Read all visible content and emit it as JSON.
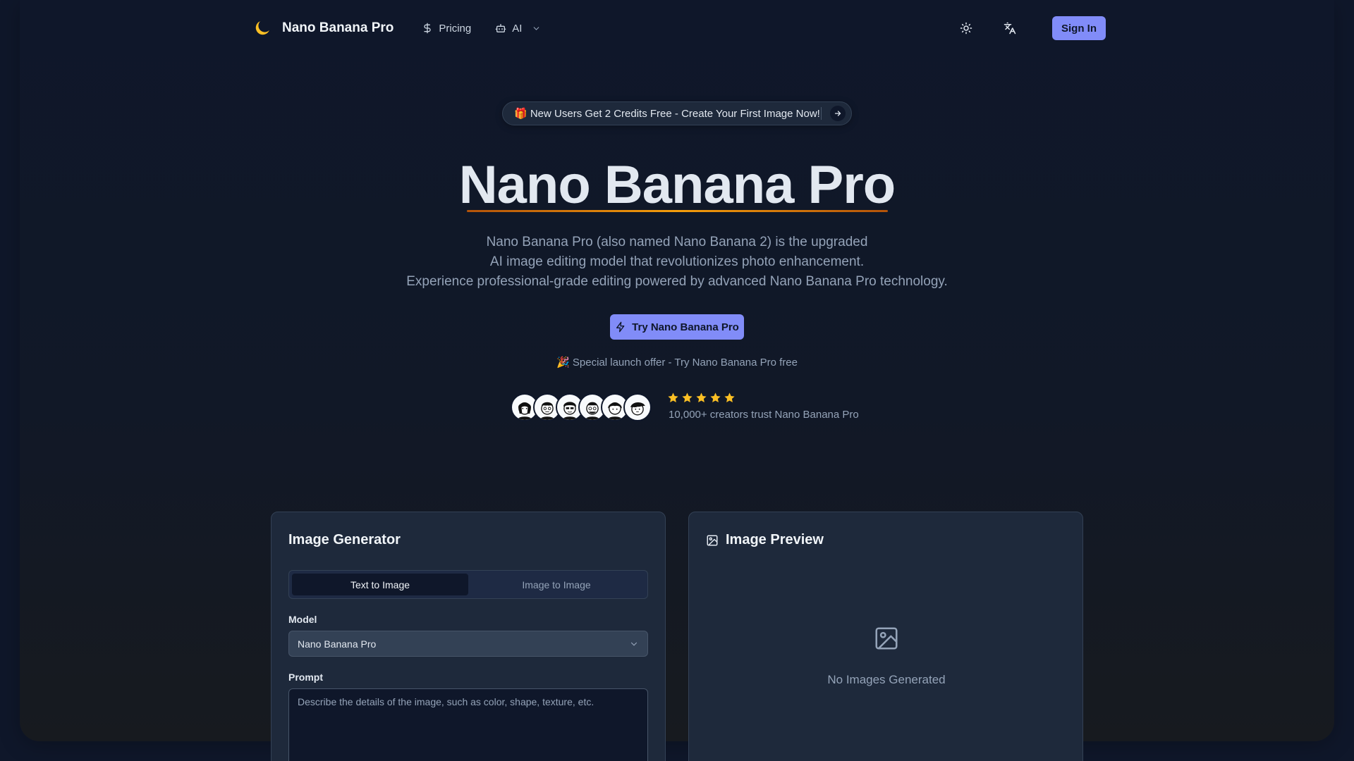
{
  "nav": {
    "brand_name": "Nano Banana Pro",
    "brand_icon": "moon-icon",
    "links": [
      {
        "label": "Pricing",
        "icon": "dollar-icon"
      },
      {
        "label": "AI",
        "icon": "bot-icon"
      }
    ],
    "theme_icon": "sun-icon",
    "language_icon": "translate-icon",
    "signin_label": "Sign In"
  },
  "announcement": {
    "text": "🎁 New Users Get 2 Credits Free - Create Your First Image Now!"
  },
  "hero": {
    "title": "Nano Banana Pro",
    "description": [
      "Nano Banana Pro (also named Nano Banana 2) is the upgraded",
      "AI image editing model that revolutionizes photo enhancement.",
      "Experience professional-grade editing powered by advanced Nano Banana Pro technology."
    ],
    "cta_label": "Try Nano Banana Pro",
    "launch_offer": "🎉 Special launch offer - Try Nano Banana Pro free"
  },
  "social_proof": {
    "rating_stars": 5,
    "trust_text": "10,000+ creators trust Nano Banana Pro"
  },
  "generator": {
    "title": "Image Generator",
    "tabs": [
      {
        "label": "Text to Image",
        "active": true
      },
      {
        "label": "Image to Image",
        "active": false
      }
    ],
    "model_label": "Model",
    "model_value": "Nano Banana Pro",
    "prompt_label": "Prompt",
    "prompt_placeholder": "Describe the details of the image, such as color, shape, texture, etc."
  },
  "preview": {
    "title": "Image Preview",
    "empty_text": "No Images Generated"
  },
  "colors": {
    "background": "#0f172a",
    "card": "#1e293b",
    "accent": "#818cf8",
    "star": "#fbbf24",
    "underline": "#f59e0b"
  }
}
